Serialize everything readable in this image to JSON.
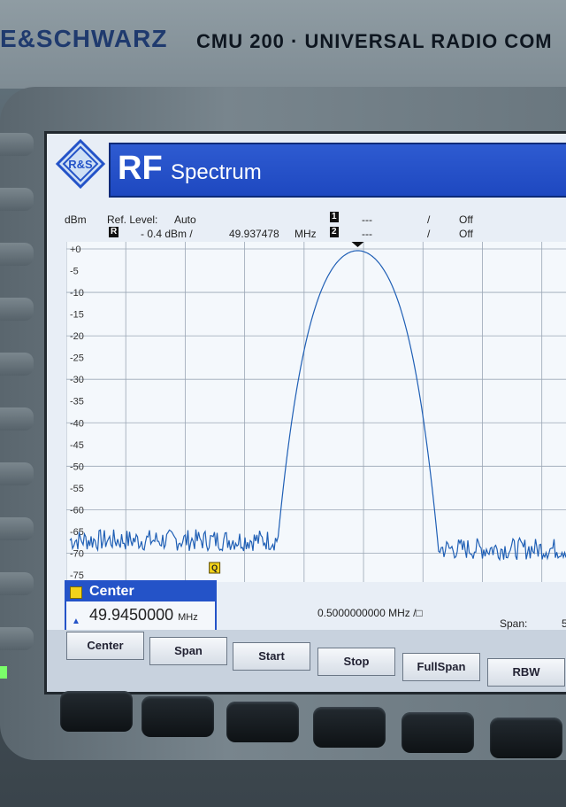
{
  "device": {
    "brand": "E&SCHWARZ",
    "model": "CMU 200  ·  UNIVERSAL RADIO COM"
  },
  "app": {
    "logo_letters": "R&S",
    "title_main": "RF",
    "title_sub": "Spectrum"
  },
  "info": {
    "unit": "dBm",
    "ref_level_label": "Ref. Level:",
    "ref_level_mode": "Auto",
    "marker_r": "R",
    "ref_level_value": "- 0.4  dBm /",
    "marker_freq": "49.937478",
    "marker_unit": "MHz",
    "marker1_label": "1",
    "marker1_value": "---",
    "marker1_sep": "/",
    "marker1_state": "Off",
    "marker2_label": "2",
    "marker2_value": "---",
    "marker2_sep": "/",
    "marker2_state": "Off"
  },
  "plot": {
    "y_ticks": [
      "+0",
      "-5",
      "-10",
      "-15",
      "-20",
      "-25",
      "-30",
      "-35",
      "-40",
      "-45",
      "-50",
      "-55",
      "-60",
      "-65",
      "-70",
      "-75"
    ],
    "ylim": [
      -75,
      0
    ],
    "peak_marker": "R",
    "q_marker": "Q",
    "trace_color": "#1f5fb5",
    "grid_color": "#9aa6b5",
    "noise_floor_dbm": -67,
    "peak_dbm": -0.4
  },
  "center_box": {
    "label": "Center",
    "value": "49.9450000",
    "unit": "MHz"
  },
  "span_readout": "0.5000000000 MHz  /□",
  "span_label": "Span:",
  "span_fragment": "5",
  "softkeys": [
    "Center",
    "Span",
    "Start",
    "Stop",
    "FullSpan",
    "RBW"
  ],
  "colors": {
    "title_blue": "#2453c8",
    "screen_bg": "#e8eef6"
  }
}
